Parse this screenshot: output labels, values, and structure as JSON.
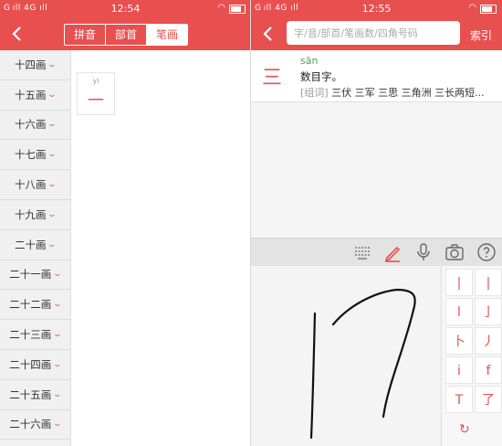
{
  "left": {
    "status": {
      "signal": "G ıll 4G ıll",
      "time": "12:54"
    },
    "tabs": [
      "拼音",
      "部首",
      "笔画"
    ],
    "active_tab": "笔画",
    "stroke_items": [
      "十四画",
      "十五画",
      "十六画",
      "十七画",
      "十八画",
      "十九画",
      "二十画",
      "二十一画",
      "二十二画",
      "二十三画",
      "二十四画",
      "二十五画",
      "二十六画"
    ],
    "result_card": {
      "pinyin": "yi",
      "char": "一"
    }
  },
  "right": {
    "status": {
      "signal": "G ıll 4G ıll",
      "time": "12:55"
    },
    "search": {
      "placeholder": "字/音/部首/笔画数/四角号码"
    },
    "index_label": "索引",
    "result": {
      "char": "三",
      "pinyin": "sān",
      "definition": "数目字。",
      "words_tag": "[组词]",
      "words": " 三伏 三军 三思 三角洲 三长两短..."
    },
    "candidates": [
      "|",
      "|",
      "l",
      "亅",
      "卜",
      "丿",
      "i",
      "f",
      "T",
      "了"
    ]
  }
}
